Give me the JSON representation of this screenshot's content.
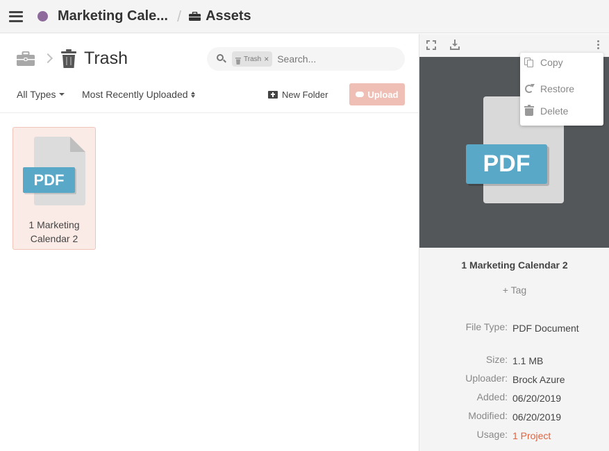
{
  "header": {
    "project_title": "Marketing Cale...",
    "separator": "/",
    "section_title": "Assets",
    "project_color": "#8e6a9c"
  },
  "location": {
    "folder_title": "Trash"
  },
  "search": {
    "chip_label": "Trash",
    "chip_remove": "×",
    "placeholder": "Search..."
  },
  "toolbar": {
    "type_filter": "All Types",
    "sort": "Most Recently Uploaded",
    "new_folder": "New Folder",
    "upload": "Upload"
  },
  "files": [
    {
      "badge": "PDF",
      "name": "1 Marketing Calendar 2"
    }
  ],
  "details": {
    "badge": "PDF",
    "name": "1 Marketing Calendar 2",
    "add_tag": "+ Tag",
    "fields": [
      {
        "label": "File Type:",
        "value": "PDF Document"
      },
      {
        "label": "Size:",
        "value": "1.1 MB"
      },
      {
        "label": "Uploader:",
        "value": "Brock Azure"
      },
      {
        "label": "Added:",
        "value": "06/20/2019"
      },
      {
        "label": "Modified:",
        "value": "06/20/2019"
      },
      {
        "label": "Usage:",
        "value": "1 Project"
      }
    ]
  },
  "context_menu": {
    "items": [
      {
        "label": "Copy",
        "icon": "copy-icon"
      },
      {
        "label": "Restore",
        "icon": "restore-icon"
      },
      {
        "label": "Delete",
        "icon": "trash-icon"
      }
    ]
  },
  "colors": {
    "accent": "#e0623f",
    "upload_button": "#efbeb4",
    "pdf_badge": "#5aa8c8",
    "preview_bg": "#545759"
  }
}
